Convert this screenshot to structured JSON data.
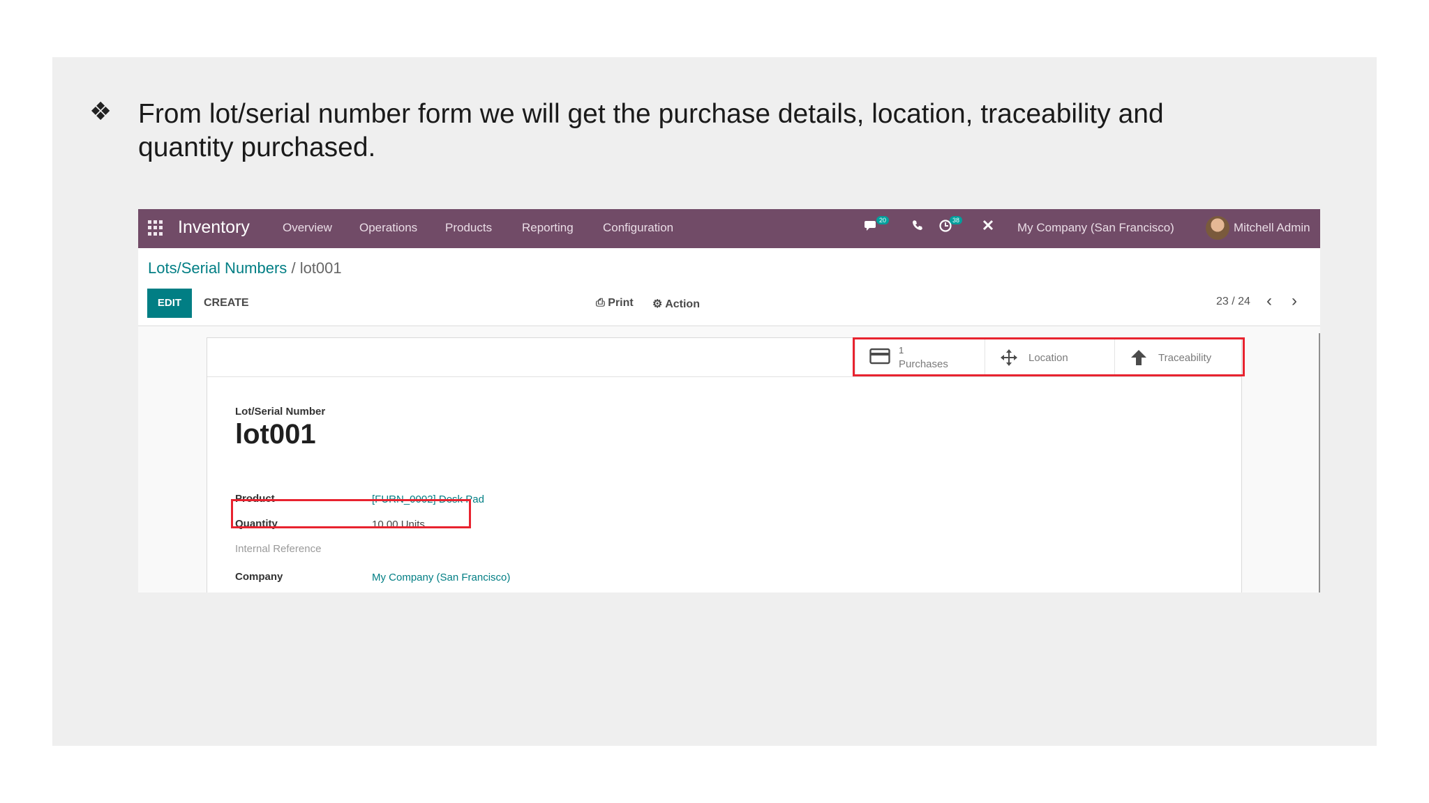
{
  "slide": {
    "bullet": "❖",
    "text": "From lot/serial number form we will get the purchase details, location, traceability and quantity purchased."
  },
  "navbar": {
    "app_name": "Inventory",
    "menu": [
      "Overview",
      "Operations",
      "Products",
      "Reporting",
      "Configuration"
    ],
    "chat_badge": "20",
    "activity_badge": "38",
    "company": "My Company (San Francisco)",
    "user": "Mitchell Admin"
  },
  "breadcrumb": {
    "parent": "Lots/Serial Numbers",
    "separator": "/",
    "current": "lot001"
  },
  "toolbar": {
    "edit_label": "EDIT",
    "create_label": "CREATE",
    "print_label": "Print",
    "action_label": "Action",
    "pager": "23 / 24"
  },
  "smart_buttons": {
    "purchases_count": "1",
    "purchases_label": "Purchases",
    "location_label": "Location",
    "traceability_label": "Traceability"
  },
  "form": {
    "name_caption": "Lot/Serial Number",
    "name": "lot001",
    "product_label": "Product",
    "product_value": "[FURN_0002] Desk Pad",
    "quantity_label": "Quantity",
    "quantity_value": "10.00 Units",
    "internal_ref_label": "Internal Reference",
    "company_label": "Company",
    "company_value": "My Company (San Francisco)"
  },
  "colors": {
    "navbar": "#714b67",
    "primary": "#017e84",
    "highlight": "#e8232f"
  }
}
